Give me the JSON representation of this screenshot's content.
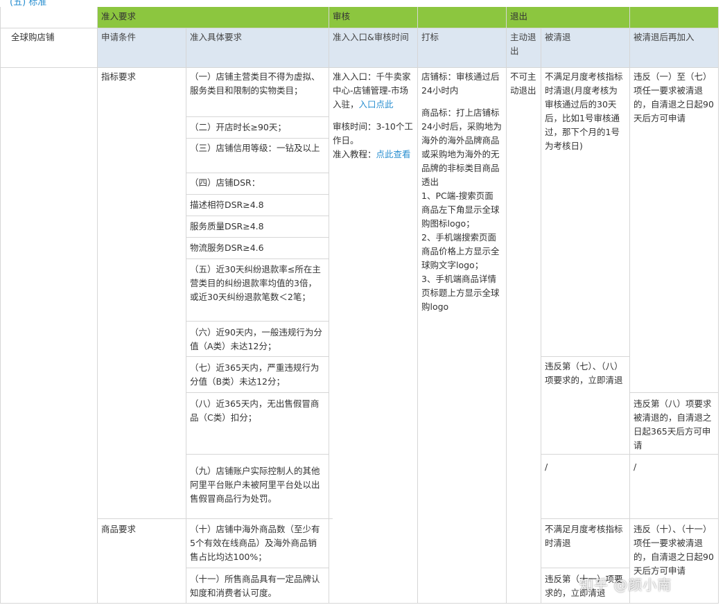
{
  "topbar": {
    "text": "(五) 标准"
  },
  "header_row": {
    "c2": "准入要求",
    "c4": "审核",
    "c6": "退出"
  },
  "sub_header": {
    "c1": "全球购店铺",
    "c2": "申请条件",
    "c3": "准入具体要求",
    "c4": "准入入口&审核时间",
    "c5": "打标",
    "c6": "主动退出",
    "c7": "被清退",
    "c8": "被清退后再加入"
  },
  "section_indicator": {
    "label": "指标要求",
    "audit_entry": "准入入口：千牛卖家中心-店铺管理-市场入驻，",
    "audit_entry_link": "入口点此",
    "audit_time": "审核时间：3-10个工作日。",
    "audit_tutorial": "准入教程：",
    "audit_tutorial_link": "点此查看",
    "tag_store": "店铺标：审核通过后24小时内",
    "tag_goods": "商品标：打上店铺标24小时后，采购地为海外的海外品牌商品或采购地为海外的无品牌的非标类目商品透出\n1、PC端-搜索页面商品左下角显示全球购图标logo；\n2、手机端搜索页面商品价格上方显示全球购文字logo；\n3、手机端商品详情页标题上方显示全球购logo",
    "active_exit": "不可主动退出",
    "cleared_1": "不满足月度考核指标时清退(月度考核为审核通过后的30天后，比如1号审核通过，那下个月的1号为考核日)",
    "rejoin_1": "违反（一）至（七）项任一要求被清退的，自清退之日起90天后方可申请",
    "cleared_2": "违反第（七）、（八）项要求的，立即清退",
    "rejoin_2": "违反第（八）项要求被清退的，自清退之日起365天后方可申请",
    "cleared_3": "/",
    "rejoin_3": "/"
  },
  "requirements": [
    "（一）店铺主营类目不得为虚拟、服务类目和限制的实物类目；",
    "（二）开店时长≥90天；",
    "（三）店铺信用等级：一钻及以上",
    "（四）店铺DSR：",
    "描述相符DSR≥4.8",
    "服务质量DSR≥4.8",
    "物流服务DSR≥4.6",
    "（五）近30天纠纷退款率≤所在主营类目的纠纷退款率均值的3倍，或近30天纠纷退款笔数＜2笔；",
    "（六）近90天内，一般违规行为分值（A类）未达12分；",
    "（七）近365天内，严重违规行为分值（B类）未达12分；",
    "（八）近365天内，无出售假冒商品（C类）扣分；",
    "（九）店铺账户实际控制人的其他阿里平台账户未被阿里平台处以出售假冒商品行为处罚。"
  ],
  "section_goods": {
    "label": "商品要求",
    "req_10": "（十）店铺中海外商品数（至少有5个有效在线商品）及海外商品销售占比均达100%；",
    "req_11": "（十一）所售商品具有一定品牌认知度和消费者认可度。",
    "cleared_1": "不满足月度考核指标时清退",
    "cleared_2": "违反第（十一）项要求的，立即清退",
    "rejoin_1": "违反（十）、（十一）项任一要求被清退的，自清退之日起90天后方可申请"
  },
  "watermark": "知乎 @颜小南",
  "colors": {
    "header_green": "#8cc63f",
    "subheader_blue": "#dce6f1",
    "link": "#2a8fd0",
    "grid": "#d6d6d6"
  }
}
